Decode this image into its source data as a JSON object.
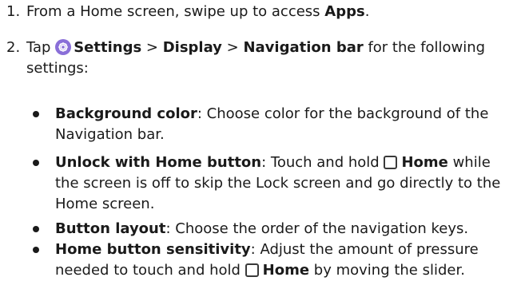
{
  "steps": [
    {
      "number": "1.",
      "pre": "From a Home screen, swipe up to access ",
      "bold": "Apps",
      "post": "."
    },
    {
      "number": "2.",
      "pre": "Tap ",
      "settings": "Settings",
      "sep1": " > ",
      "display": "Display",
      "sep2": " > ",
      "navbar": "Navigation bar",
      "post": " for the following settings:"
    }
  ],
  "bullets": [
    {
      "term": "Background color",
      "desc": ": Choose color for the background of the Navigation bar."
    },
    {
      "term": "Unlock with Home button",
      "desc_pre": ": Touch and hold ",
      "home": "Home",
      "desc_post": " while the screen is off to skip the Lock screen and go directly to the Home screen."
    },
    {
      "term": "Button layout",
      "desc": ": Choose the order of the navigation keys."
    },
    {
      "term": "Home button sensitivity",
      "desc_pre": ": Adjust the amount of pressure needed to touch and hold ",
      "home": "Home",
      "desc_post": " by moving the slider."
    }
  ],
  "icons": {
    "settings": "settings-gear-icon",
    "home": "home-button-icon"
  },
  "colors": {
    "settings_icon": "#8a6fd8",
    "text": "#1a1a1a"
  }
}
